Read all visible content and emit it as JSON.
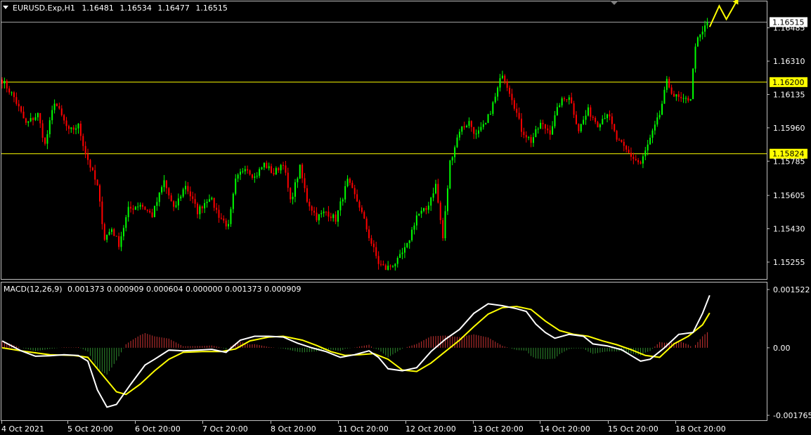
{
  "header": {
    "symbol": "EURUSD.Exp,H1",
    "open": "1.16481",
    "high": "1.16534",
    "low": "1.16477",
    "close": "1.16515"
  },
  "macd_header": {
    "label": "MACD(12,26,9)",
    "values": "0.001373 0.000909 0.000604 0.000000 0.001373 0.000909"
  },
  "colors": {
    "background": "#000000",
    "bull": "#00ff00",
    "bear": "#ff0000",
    "level_line": "#ffff00",
    "macd_line": "#ffffff",
    "signal_line": "#ffff00",
    "hist_pos": "#cc3333",
    "hist_neg": "#2e8b2e",
    "price_line": "#a0a0a0",
    "arrow": "#ffff00"
  },
  "price_axis": {
    "ticks": [
      "1.16485",
      "1.16310",
      "1.16135",
      "1.15960",
      "1.15785",
      "1.15605",
      "1.15430",
      "1.15255"
    ]
  },
  "current_price": {
    "label": "1.16515",
    "value": 1.16515
  },
  "levels": [
    {
      "label": "1.16200",
      "value": 1.162
    },
    {
      "label": "1.15824",
      "value": 1.15824
    }
  ],
  "macd_axis": {
    "ticks": [
      {
        "label": "0.001522",
        "value": 0.001522
      },
      {
        "label": "0.00",
        "value": 0.0
      },
      {
        "label": "-0.001765",
        "value": -0.001765
      }
    ]
  },
  "time_axis": {
    "labels": [
      "4 Oct 2021",
      "5 Oct 20:00",
      "6 Oct 20:00",
      "7 Oct 20:00",
      "8 Oct 20:00",
      "11 Oct 20:00",
      "12 Oct 20:00",
      "13 Oct 20:00",
      "14 Oct 20:00",
      "15 Oct 20:00",
      "18 Oct 20:00"
    ]
  },
  "chart_data": {
    "type": "candlestick",
    "symbol": "EURUSD.Exp,H1",
    "ylim": [
      1.1517,
      1.1662
    ],
    "price_path": [
      [
        0,
        1.1621
      ],
      [
        5,
        1.1612
      ],
      [
        10,
        1.1598
      ],
      [
        15,
        1.1603
      ],
      [
        18,
        1.1587
      ],
      [
        22,
        1.161
      ],
      [
        28,
        1.1594
      ],
      [
        32,
        1.1597
      ],
      [
        35,
        1.1583
      ],
      [
        40,
        1.1565
      ],
      [
        43,
        1.1538
      ],
      [
        46,
        1.1543
      ],
      [
        49,
        1.1535
      ],
      [
        53,
        1.1553
      ],
      [
        58,
        1.1556
      ],
      [
        63,
        1.155
      ],
      [
        68,
        1.1568
      ],
      [
        72,
        1.1553
      ],
      [
        77,
        1.1566
      ],
      [
        82,
        1.1552
      ],
      [
        87,
        1.156
      ],
      [
        91,
        1.155
      ],
      [
        95,
        1.1544
      ],
      [
        98,
        1.1568
      ],
      [
        102,
        1.1576
      ],
      [
        106,
        1.157
      ],
      [
        110,
        1.1577
      ],
      [
        114,
        1.1572
      ],
      [
        118,
        1.1578
      ],
      [
        121,
        1.1557
      ],
      [
        125,
        1.1575
      ],
      [
        128,
        1.1558
      ],
      [
        132,
        1.1549
      ],
      [
        136,
        1.1552
      ],
      [
        140,
        1.1548
      ],
      [
        145,
        1.1568
      ],
      [
        150,
        1.1555
      ],
      [
        154,
        1.1539
      ],
      [
        158,
        1.1525
      ],
      [
        161,
        1.1522
      ],
      [
        166,
        1.1526
      ],
      [
        170,
        1.1534
      ],
      [
        174,
        1.155
      ],
      [
        178,
        1.1553
      ],
      [
        182,
        1.1566
      ],
      [
        185,
        1.1538
      ],
      [
        188,
        1.1578
      ],
      [
        192,
        1.1595
      ],
      [
        196,
        1.1599
      ],
      [
        199,
        1.1592
      ],
      [
        203,
        1.1598
      ],
      [
        207,
        1.1612
      ],
      [
        210,
        1.1625
      ],
      [
        214,
        1.1612
      ],
      [
        218,
        1.1595
      ],
      [
        222,
        1.1589
      ],
      [
        226,
        1.1598
      ],
      [
        230,
        1.1594
      ],
      [
        234,
        1.1609
      ],
      [
        238,
        1.1613
      ],
      [
        242,
        1.1595
      ],
      [
        246,
        1.1605
      ],
      [
        250,
        1.1598
      ],
      [
        254,
        1.1604
      ],
      [
        258,
        1.159
      ],
      [
        262,
        1.1584
      ],
      [
        265,
        1.158
      ],
      [
        268,
        1.1577
      ],
      [
        272,
        1.159
      ],
      [
        276,
        1.1603
      ],
      [
        279,
        1.162
      ],
      [
        282,
        1.1613
      ],
      [
        286,
        1.161
      ],
      [
        289,
        1.1612
      ],
      [
        291,
        1.164
      ],
      [
        294,
        1.1646
      ],
      [
        296,
        1.1652
      ]
    ],
    "macd": [
      [
        0,
        0.00018
      ],
      [
        8,
        -8e-05
      ],
      [
        14,
        -0.00022
      ],
      [
        20,
        -0.00021
      ],
      [
        26,
        -0.00018
      ],
      [
        32,
        -0.0002
      ],
      [
        36,
        -0.00035
      ],
      [
        40,
        -0.0011
      ],
      [
        44,
        -0.00155
      ],
      [
        48,
        -0.00148
      ],
      [
        54,
        -0.00095
      ],
      [
        60,
        -0.00045
      ],
      [
        64,
        -0.0003
      ],
      [
        70,
        -6e-05
      ],
      [
        76,
        -8e-05
      ],
      [
        82,
        -6e-05
      ],
      [
        88,
        -4e-05
      ],
      [
        94,
        -0.00012
      ],
      [
        100,
        0.0002
      ],
      [
        106,
        0.0003
      ],
      [
        112,
        0.0003
      ],
      [
        118,
        0.00028
      ],
      [
        124,
        0.00012
      ],
      [
        130,
        0.0
      ],
      [
        136,
        -0.0001
      ],
      [
        142,
        -0.00025
      ],
      [
        148,
        -0.00018
      ],
      [
        154,
        -8e-05
      ],
      [
        158,
        -0.00025
      ],
      [
        162,
        -0.00055
      ],
      [
        168,
        -0.0006
      ],
      [
        174,
        -0.00052
      ],
      [
        180,
        -0.0001
      ],
      [
        186,
        0.00022
      ],
      [
        192,
        0.00048
      ],
      [
        198,
        0.0009
      ],
      [
        204,
        0.00115
      ],
      [
        210,
        0.0011
      ],
      [
        216,
        0.00102
      ],
      [
        220,
        0.00095
      ],
      [
        224,
        0.00062
      ],
      [
        228,
        0.0004
      ],
      [
        232,
        0.00025
      ],
      [
        238,
        0.00035
      ],
      [
        244,
        0.0003
      ],
      [
        248,
        0.0001
      ],
      [
        254,
        5e-05
      ],
      [
        260,
        -5e-05
      ],
      [
        264,
        -0.0002
      ],
      [
        268,
        -0.00035
      ],
      [
        272,
        -0.0003
      ],
      [
        278,
        0.0
      ],
      [
        284,
        0.00035
      ],
      [
        290,
        0.0004
      ],
      [
        294,
        0.0009
      ],
      [
        297,
        0.00137
      ]
    ],
    "signal": [
      [
        0,
        0.0
      ],
      [
        10,
        -0.0001
      ],
      [
        20,
        -0.00018
      ],
      [
        30,
        -0.0002
      ],
      [
        36,
        -0.00025
      ],
      [
        42,
        -0.0007
      ],
      [
        48,
        -0.00115
      ],
      [
        52,
        -0.00122
      ],
      [
        58,
        -0.00095
      ],
      [
        64,
        -0.0006
      ],
      [
        70,
        -0.0003
      ],
      [
        76,
        -0.00012
      ],
      [
        84,
        -0.0001
      ],
      [
        92,
        -0.0001
      ],
      [
        98,
        -3e-05
      ],
      [
        104,
        0.00018
      ],
      [
        112,
        0.00028
      ],
      [
        118,
        0.0003
      ],
      [
        126,
        0.0002
      ],
      [
        132,
        6e-05
      ],
      [
        138,
        -0.0001
      ],
      [
        144,
        -0.0002
      ],
      [
        150,
        -0.00018
      ],
      [
        156,
        -0.00015
      ],
      [
        162,
        -0.0003
      ],
      [
        168,
        -0.00058
      ],
      [
        174,
        -0.00062
      ],
      [
        180,
        -0.0004
      ],
      [
        186,
        -0.0001
      ],
      [
        192,
        0.0002
      ],
      [
        198,
        0.00055
      ],
      [
        204,
        0.00088
      ],
      [
        210,
        0.00105
      ],
      [
        216,
        0.00108
      ],
      [
        222,
        0.001
      ],
      [
        228,
        0.0007
      ],
      [
        234,
        0.00045
      ],
      [
        240,
        0.00035
      ],
      [
        246,
        0.0003
      ],
      [
        252,
        0.00018
      ],
      [
        258,
        8e-05
      ],
      [
        264,
        -5e-05
      ],
      [
        270,
        -0.0002
      ],
      [
        276,
        -0.00025
      ],
      [
        282,
        0.0001
      ],
      [
        288,
        0.0003
      ],
      [
        294,
        0.0006
      ],
      [
        297,
        0.00091
      ]
    ],
    "forecast_arrow": [
      [
        297,
        1.1649
      ],
      [
        301,
        1.166
      ],
      [
        304,
        1.1653
      ],
      [
        309,
        1.1664
      ]
    ]
  }
}
